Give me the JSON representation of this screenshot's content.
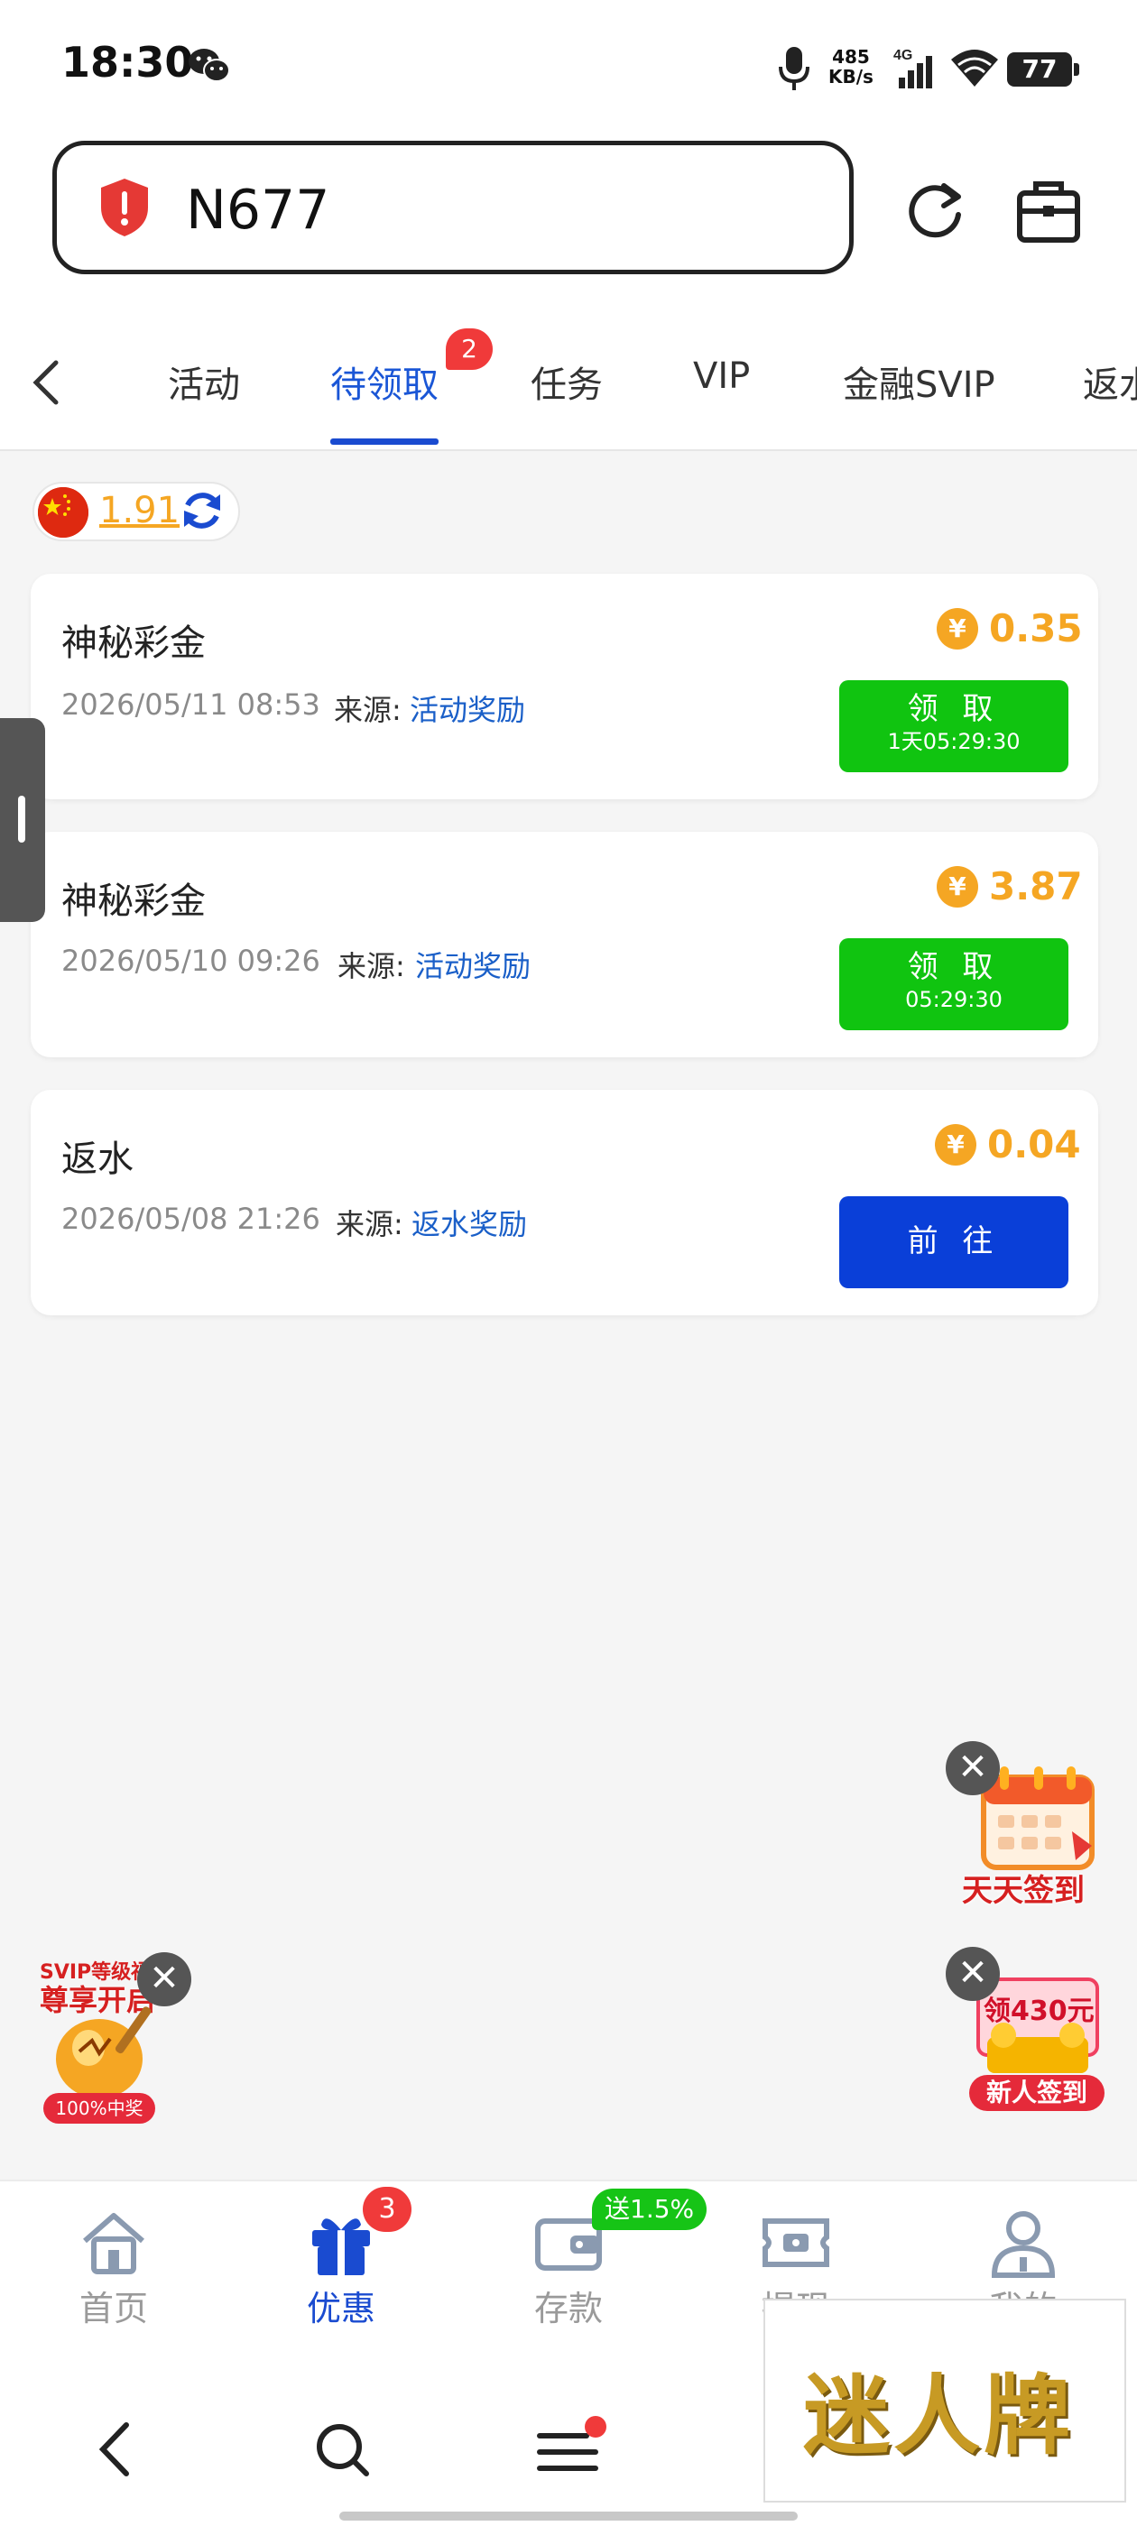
{
  "status_bar": {
    "time": "18:30",
    "net_speed_value": "485",
    "net_speed_unit": "KB/s",
    "network": "4G",
    "battery": "77"
  },
  "address_bar": {
    "url": "N677",
    "security_icon": "warning-shield-icon"
  },
  "tabs": {
    "items": [
      {
        "label": "活动"
      },
      {
        "label": "待领取",
        "badge": "2"
      },
      {
        "label": "任务"
      },
      {
        "label": "VIP"
      },
      {
        "label": "金融SVIP"
      },
      {
        "label": "返水"
      }
    ],
    "active_index": 1
  },
  "wallet": {
    "balance": "1.91"
  },
  "rewards": [
    {
      "title": "神秘彩金",
      "date": "2026/05/11 08:53",
      "source_label": "来源:",
      "source": "活动奖励",
      "coin_symbol": "¥",
      "amount": "0.35",
      "button_label": "领 取",
      "button_sub": "1天05:29:30",
      "button_color": "#10c410"
    },
    {
      "title": "神秘彩金",
      "date": "2026/05/10 09:26",
      "source_label": "来源:",
      "source": "活动奖励",
      "coin_symbol": "¥",
      "amount": "3.87",
      "button_label": "领 取",
      "button_sub": "05:29:30",
      "button_color": "#10c410"
    },
    {
      "title": "返水",
      "date": "2026/05/08 21:26",
      "source_label": "来源:",
      "source": "返水奖励",
      "coin_symbol": "¥",
      "amount": "0.04",
      "button_label": "前 往",
      "button_color": "#0a3fd8"
    }
  ],
  "floating": {
    "daily_checkin": "天天签到",
    "newbie_amount": "领430元",
    "newbie_checkin": "新人签到",
    "svip_line1": "SVIP等级福利",
    "svip_line2": "尊享开启",
    "svip_tag": "100%中奖",
    "close_symbol": "✕"
  },
  "bottom_nav": {
    "items": [
      {
        "label": "首页",
        "icon": "home-icon"
      },
      {
        "label": "优惠",
        "icon": "gift-icon",
        "badge": "3"
      },
      {
        "label": "存款",
        "icon": "wallet-icon",
        "tag": "送1.5%"
      },
      {
        "label": "提现",
        "icon": "withdraw-icon"
      },
      {
        "label": "我的",
        "icon": "profile-icon"
      }
    ],
    "active_index": 1
  },
  "watermark": "迷人牌",
  "colors": {
    "accent": "#1a4bd0",
    "amount": "#f5a623",
    "claim_button": "#10c410",
    "go_button": "#0a3fd8",
    "badge": "#f03a3a"
  }
}
